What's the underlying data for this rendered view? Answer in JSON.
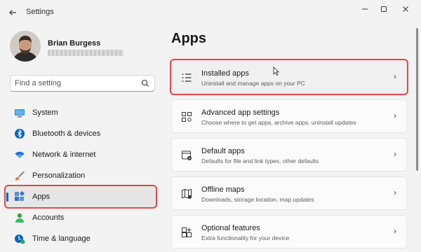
{
  "window": {
    "title": "Settings"
  },
  "user": {
    "name": "Brian Burgess"
  },
  "search": {
    "placeholder": "Find a setting"
  },
  "sidebar": {
    "items": [
      {
        "label": "System",
        "icon": "system-icon",
        "color": "#0078d4"
      },
      {
        "label": "Bluetooth & devices",
        "icon": "bluetooth-icon",
        "color": "#0078d4"
      },
      {
        "label": "Network & internet",
        "icon": "wifi-icon",
        "color": "#0f6cbd"
      },
      {
        "label": "Personalization",
        "icon": "brush-icon",
        "color": "#e07b39"
      },
      {
        "label": "Apps",
        "icon": "apps-icon",
        "color": "#3a6fb5",
        "active": true
      },
      {
        "label": "Accounts",
        "icon": "accounts-icon",
        "color": "#2fa84f"
      },
      {
        "label": "Time & language",
        "icon": "time-language-icon",
        "color": "#0078d4"
      }
    ]
  },
  "main": {
    "title": "Apps",
    "cards": [
      {
        "title": "Installed apps",
        "desc": "Uninstall and manage apps on your PC",
        "icon": "installed-apps-icon",
        "highlighted": true
      },
      {
        "title": "Advanced app settings",
        "desc": "Choose where to get apps, archive apps, uninstall updates",
        "icon": "advanced-app-settings-icon"
      },
      {
        "title": "Default apps",
        "desc": "Defaults for file and link types, other defaults",
        "icon": "default-apps-icon"
      },
      {
        "title": "Offline maps",
        "desc": "Downloads, storage location, map updates",
        "icon": "offline-maps-icon"
      },
      {
        "title": "Optional features",
        "desc": "Extra functionality for your device",
        "icon": "optional-features-icon"
      }
    ]
  },
  "colors": {
    "accent": "#0067c0",
    "highlight_box": "#e5484d"
  }
}
